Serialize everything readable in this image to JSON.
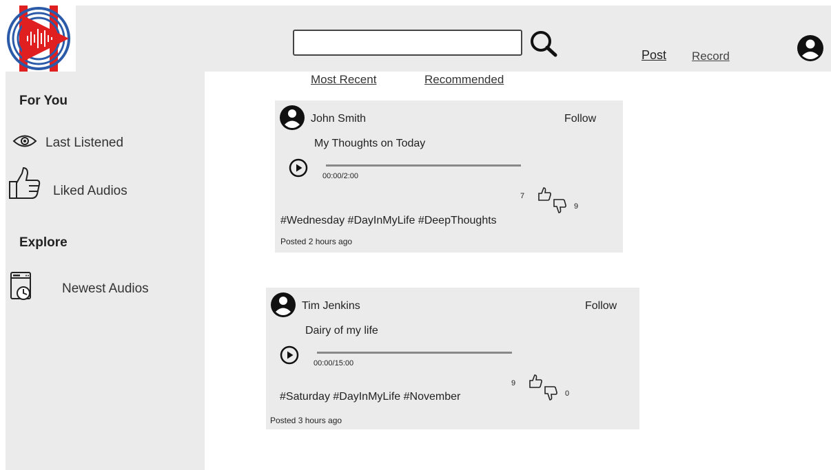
{
  "brand": {
    "primary": "#e02020",
    "ring": "#2a5aa8",
    "surface": "#ebebeb"
  },
  "header": {
    "search": {
      "value": "",
      "placeholder": ""
    },
    "links": {
      "post": "Post",
      "record": "Record"
    }
  },
  "sidebar": {
    "for_you": "For You",
    "last_listened": "Last Listened",
    "liked_audios": "Liked Audios",
    "explore": "Explore",
    "newest_audios": "Newest Audios"
  },
  "tabs": {
    "most_recent": "Most Recent",
    "recommended": "Recommended"
  },
  "posts": [
    {
      "author": "John Smith",
      "follow": "Follow",
      "title": "My Thoughts on Today",
      "time": "00:00/2:00",
      "progress": 0,
      "likes": "7",
      "dislikes": "9",
      "tags": "#Wednesday #DayInMyLife #DeepThoughts",
      "posted": "Posted 2 hours ago"
    },
    {
      "author": "Tim Jenkins",
      "follow": "Follow",
      "title": "Dairy of my life",
      "time": "00:00/15:00",
      "progress": 0,
      "likes": "9",
      "dislikes": "0",
      "tags": "#Saturday #DayInMyLife #November",
      "posted": "Posted 3 hours ago"
    }
  ]
}
